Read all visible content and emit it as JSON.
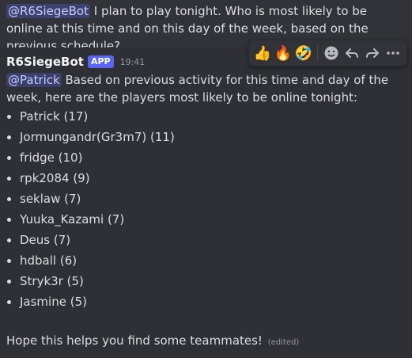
{
  "top_message": {
    "mention": "@R6SiegeBot",
    "text": " I plan to play tonight. Who is most likely to be online at this time and on this day of the week, based on the previous schedule?"
  },
  "bot_message": {
    "username": "R6SiegeBot",
    "tag": "APP",
    "timestamp": "19:41",
    "mention": "@Patrick",
    "intro_text": " Based on previous activity for this time and day of the week, here are the players most likely to be online tonight:",
    "players": [
      "Patrick (17)",
      "Jormungandr(Gr3m7) (11)",
      "fridge (10)",
      "rpk2084 (9)",
      "seklaw (7)",
      "Yuuka_Kazami (7)",
      "Deus (7)",
      "hdball (6)",
      "Stryk3r (5)",
      "Jasmine (5)"
    ],
    "outro_text": "Hope this helps you find some teammates!",
    "edited_label": "(edited)"
  },
  "toolbar": {
    "reactions": [
      "👍",
      "🔥",
      "🤣"
    ],
    "add_reaction_icon": "☺",
    "reply_icon": "↩",
    "forward_icon": "↪",
    "more_icon": "⋯"
  },
  "colors": {
    "background": "#313338",
    "hover_background": "#2e3035",
    "mention_bg": "#3c4270",
    "app_tag": "#5865f2",
    "text": "#dbdee1",
    "muted": "#949ba4"
  }
}
